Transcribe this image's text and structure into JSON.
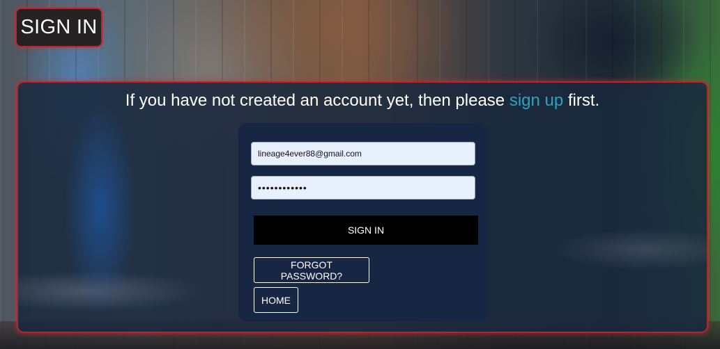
{
  "page": {
    "title": "SIGN IN"
  },
  "headline": {
    "prefix": "If you have not created an account yet, then please ",
    "link": "sign up",
    "suffix": " first."
  },
  "form": {
    "email_value": "lineage4ever88@gmail.com",
    "password_value": "••••••••••••",
    "signin_label": "SIGN IN",
    "forgot_label": "FORGOT PASSWORD?",
    "home_label": "HOME"
  },
  "colors": {
    "accent_red": "#b3262e",
    "link": "#2ea3c0",
    "card_bg": "#172643",
    "field_bg": "#e8f0fe"
  }
}
